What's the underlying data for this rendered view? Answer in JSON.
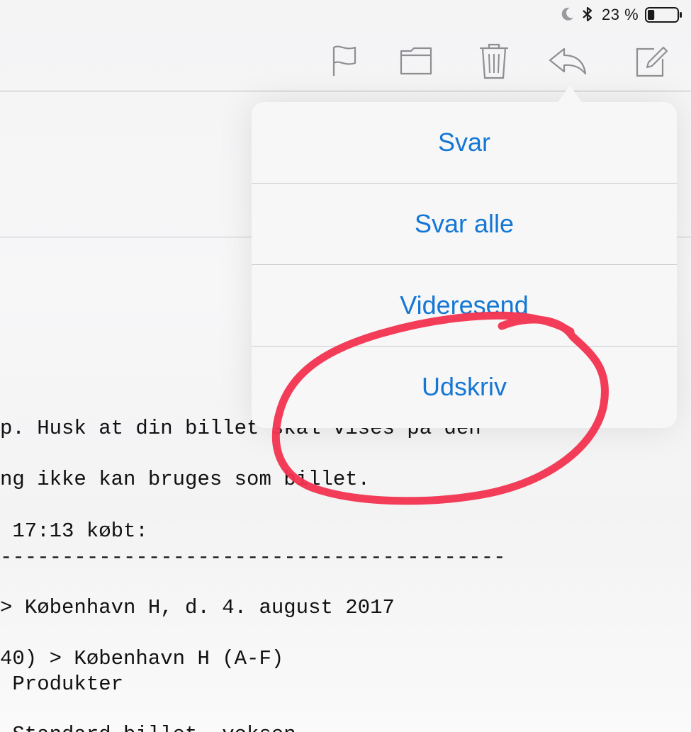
{
  "status_bar": {
    "battery_percent": "23 %",
    "icons": [
      "moon-icon",
      "bluetooth-icon",
      "battery-icon"
    ],
    "battery_level": 0.23
  },
  "toolbar": {
    "buttons": [
      {
        "name": "flag",
        "icon": "flag-icon"
      },
      {
        "name": "folder",
        "icon": "folder-icon"
      },
      {
        "name": "trash",
        "icon": "trash-icon"
      },
      {
        "name": "reply",
        "icon": "reply-icon"
      },
      {
        "name": "compose",
        "icon": "compose-icon"
      }
    ],
    "icon_color": "#8e8e93"
  },
  "popover": {
    "items": [
      {
        "label": "Svar"
      },
      {
        "label": "Svar alle"
      },
      {
        "label": "Videresend"
      },
      {
        "label": "Udskriv"
      }
    ],
    "text_color": "#1577d4"
  },
  "email_body": {
    "lines": [
      "p. Husk at din billet skal vises på den",
      "ng ikke kan bruges som billet.",
      " 17:13 købt:",
      "-----------------------------------------",
      "> København H, d. 4. august 2017",
      "40) > København H (A-F)",
      " Produkter",
      " Standard billet, voksen"
    ]
  },
  "annotation": {
    "color": "#f2334f",
    "shape": "hand-drawn-circle"
  }
}
